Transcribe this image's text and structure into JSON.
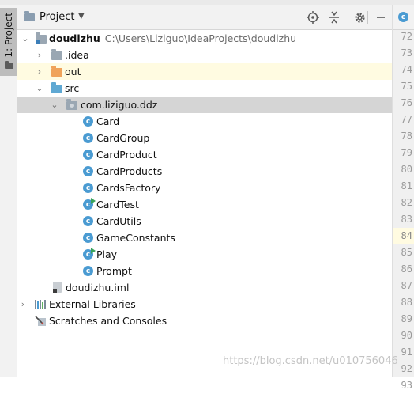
{
  "tool_window_tab": {
    "label": "1: Project"
  },
  "header": {
    "title": "Project"
  },
  "tree": {
    "root": {
      "name": "doudizhu",
      "path": "C:\\Users\\Liziguo\\IdeaProjects\\doudizhu"
    },
    "idea_folder": ".idea",
    "out_folder": "out",
    "src_folder": "src",
    "package": "com.liziguo.ddz",
    "classes": [
      "Card",
      "CardGroup",
      "CardProduct",
      "CardProducts",
      "CardsFactory",
      "CardTest",
      "CardUtils",
      "GameConstants",
      "Play",
      "Prompt"
    ],
    "iml_file": "doudizhu.iml",
    "external_libraries": "External Libraries",
    "scratches": "Scratches and Consoles"
  },
  "gutter": {
    "line_numbers": [
      "72",
      "73",
      "74",
      "75",
      "76",
      "77",
      "78",
      "79",
      "80",
      "81",
      "82",
      "83",
      "84",
      "85",
      "86",
      "87",
      "88",
      "89",
      "90",
      "91",
      "92",
      "93"
    ],
    "current_line": "84"
  },
  "watermark": "https://blog.csdn.net/u010756046",
  "colors": {
    "selection": "#d5d5d5",
    "class_icon": "#4a9bd2",
    "out_folder": "#f0a35b",
    "src_folder": "#5fa8d3",
    "highlight_row": "#fffbe1"
  }
}
